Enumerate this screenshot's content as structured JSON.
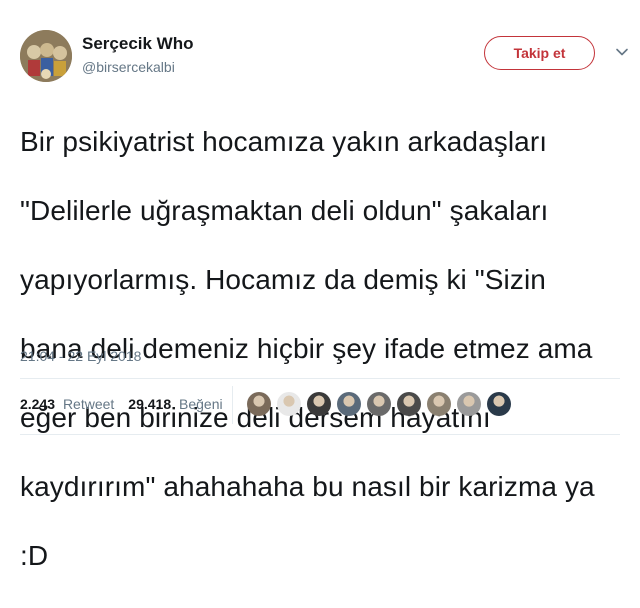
{
  "author": {
    "name": "Serçecik Who",
    "handle": "@birsercekalbi",
    "avatar_icon": "profile-avatar"
  },
  "follow_button": {
    "label": "Takip et",
    "color": "#c3343a"
  },
  "menu_icon": "chevron-down-icon",
  "tweet": {
    "lines": [
      "Bir psikiyatrist hocamıza yakın arkadaşları",
      "\"Delilerle uğraşmaktan deli oldun\" şakaları",
      "yapıyorlarmış. Hocamız da demiş ki \"Sizin",
      "bana deli demeniz hiçbir şey ifade etmez ama",
      "eğer ben birinize deli dersem hayatını",
      "kaydırırım\" ahahahaha bu nasıl bir karizma ya",
      ":D"
    ],
    "timestamp": "21:04 - 22 Eyl 2018"
  },
  "stats": {
    "retweets": {
      "count": "2.243",
      "label": "Retweet"
    },
    "likes": {
      "count": "29.418",
      "label": "Beğeni"
    }
  },
  "likers": [
    {
      "color": "#7a6a5a"
    },
    {
      "color": "#e8e8e8"
    },
    {
      "color": "#3a3a3a"
    },
    {
      "color": "#5a6a7a"
    },
    {
      "color": "#6a6a6a"
    },
    {
      "color": "#4a4a4a"
    },
    {
      "color": "#8a8070"
    },
    {
      "color": "#9a9a9a"
    },
    {
      "color": "#2a3a4a"
    }
  ]
}
